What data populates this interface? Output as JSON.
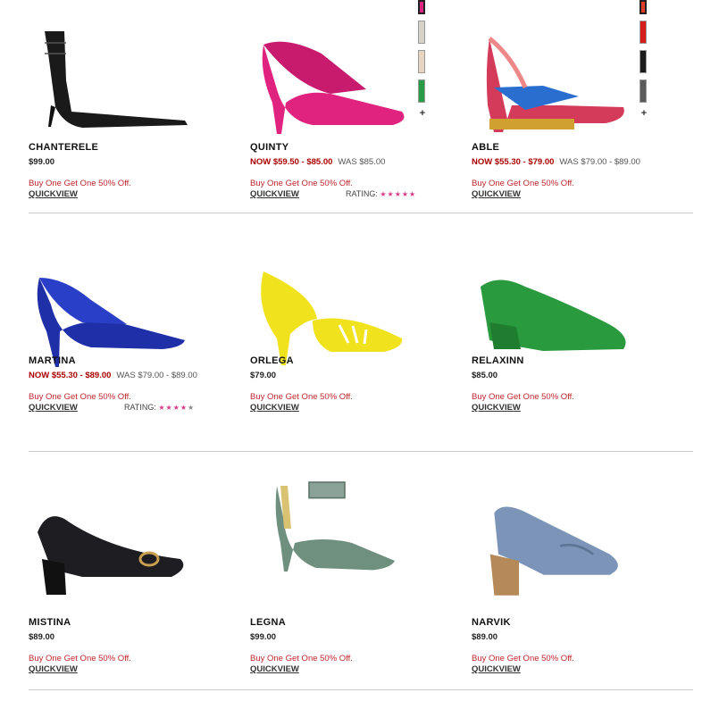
{
  "products": [
    {
      "name": "CHANTERELE",
      "price": "$99.00",
      "now": "",
      "was": "",
      "promo": "Buy One Get One 50% Off.",
      "quickview": "QUICKVIEW",
      "rating_label": "",
      "stars": 0,
      "swatches": []
    },
    {
      "name": "QUINTY",
      "price": "",
      "now": "NOW $59.50 - $85.00",
      "was": "WAS $85.00",
      "promo": "Buy One Get One 50% Off.",
      "quickview": "QUICKVIEW",
      "rating_label": "RATING:",
      "stars": 5,
      "swatches": [
        "#e0237e",
        "#d9d2c6",
        "#e6d5c0",
        "#2a9c47"
      ]
    },
    {
      "name": "ABLE",
      "price": "",
      "now": "NOW $55.30 - $79.00",
      "was": "WAS $79.00 - $89.00",
      "promo": "Buy One Get One 50% Off.",
      "quickview": "QUICKVIEW",
      "rating_label": "",
      "stars": 0,
      "swatches": [
        "#e83a2a",
        "#d61b1b",
        "#1b1b1b",
        "#5a5a5a"
      ]
    },
    {
      "name": "MARTINA",
      "price": "",
      "now": "NOW $55.30 - $89.00",
      "was": "WAS $79.00 - $89.00",
      "promo": "Buy One Get One 50% Off.",
      "quickview": "QUICKVIEW",
      "rating_label": "RATING:",
      "stars": 4,
      "swatches": [
        "#1a2b9c",
        "#141414",
        "#e0217e",
        "#f2e51a"
      ]
    },
    {
      "name": "ORLEGA",
      "price": "$79.00",
      "now": "",
      "was": "",
      "promo": "Buy One Get One 50% Off.",
      "quickview": "QUICKVIEW",
      "rating_label": "",
      "stars": 0,
      "swatches": [
        "#e3d21f",
        "#2e9a46",
        "#2a2a33",
        "#d91d7d"
      ]
    },
    {
      "name": "RELAXINN",
      "price": "$85.00",
      "now": "",
      "was": "",
      "promo": "Buy One Get One 50% Off.",
      "quickview": "QUICKVIEW",
      "rating_label": "",
      "stars": 0,
      "swatches": [
        "#219a46",
        "#161616",
        "#111111",
        "#e2d3c1"
      ]
    },
    {
      "name": "MISTINA",
      "price": "$89.00",
      "now": "",
      "was": "",
      "promo": "Buy One Get One 50% Off.",
      "quickview": "QUICKVIEW",
      "rating_label": "",
      "stars": 0,
      "swatches": [
        "#23232a",
        "#e5d1b8",
        "#e3d1b9"
      ]
    },
    {
      "name": "LEGNA",
      "price": "$99.00",
      "now": "",
      "was": "",
      "promo": "Buy One Get One 50% Off.",
      "quickview": "QUICKVIEW",
      "rating_label": "",
      "stars": 0,
      "swatches": [
        "#7a9589",
        "#1c1c20",
        "#b89c84"
      ]
    },
    {
      "name": "NARVIK",
      "price": "$89.00",
      "now": "",
      "was": "",
      "promo": "Buy One Get One 50% Off.",
      "quickview": "QUICKVIEW",
      "rating_label": "",
      "stars": 0,
      "swatches": [
        "#6f87a8",
        "#222226",
        "#8a6650"
      ]
    }
  ],
  "more_colors_symbol": "+",
  "star_char": "★"
}
